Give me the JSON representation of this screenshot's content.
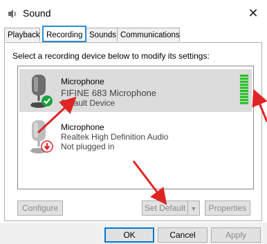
{
  "window": {
    "title": "Sound"
  },
  "tabs": [
    {
      "label": "Playback"
    },
    {
      "label": "Recording"
    },
    {
      "label": "Sounds"
    },
    {
      "label": "Communications"
    }
  ],
  "instruction": "Select a recording device below to modify its settings:",
  "devices": [
    {
      "name": "Microphone",
      "description": "FIFINE 683 Microphone",
      "status": "Default Device",
      "status_icon": "check-icon",
      "selected": true
    },
    {
      "name": "Microphone",
      "description": "Realtek High Definition Audio",
      "status": "Not plugged in",
      "status_icon": "unplugged-icon",
      "selected": false
    }
  ],
  "buttons": {
    "configure": "Configure",
    "set_default": "Set Default",
    "properties": "Properties",
    "ok": "OK",
    "cancel": "Cancel",
    "apply": "Apply"
  },
  "colors": {
    "accent": "#2e8ad8",
    "level_green": "#21c121",
    "status_green": "#1aa33f",
    "status_red": "#e0202a",
    "annotation_red": "#e02424"
  },
  "level_meter": {
    "fraction": 1.0
  }
}
